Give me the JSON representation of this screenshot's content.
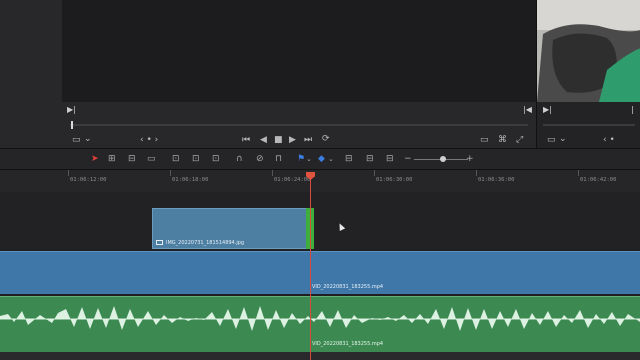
{
  "viewer": {
    "in_mark": "▶|",
    "out_mark": "|◀",
    "transport": {
      "skip_back": "⏮",
      "step_back": "◀",
      "stop": "■",
      "play": "▶",
      "skip_forward": "⏭",
      "loop": "⟳"
    },
    "nav": "‹ • ›",
    "layout_icon": "▭",
    "dropdown": "⌄"
  },
  "toolbar": {
    "icons": [
      "selection-arrow-icon",
      "trim-icon",
      "dynamic-trim-icon",
      "blade-icon",
      "insert-icon",
      "overwrite-icon",
      "replace-icon",
      "snapping-icon",
      "linked-selection-icon",
      "position-lock-icon",
      "flag-icon",
      "marker-icon",
      "zoom-full-icon",
      "zoom-detail-icon",
      "zoom-custom-icon"
    ],
    "zoom_minus": "−",
    "zoom_plus": "+"
  },
  "ruler": {
    "timecodes": [
      "01:06:12:00",
      "01:06:18:00",
      "01:06:24:00",
      "01:06:30:00",
      "01:06:36:00",
      "01:06:42:00"
    ]
  },
  "clips": {
    "still": "IMG_20220731_181514894.jpg",
    "video": "VID_20220831_183255.mp4",
    "audio": "VID_20220831_183255.mp4"
  }
}
